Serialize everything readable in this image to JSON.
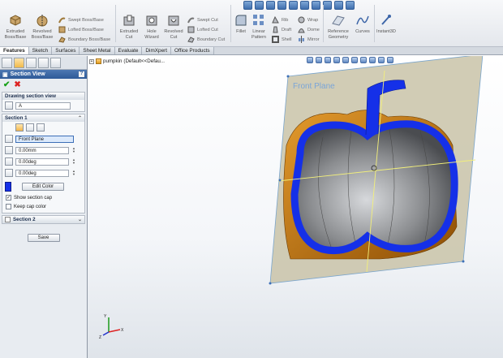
{
  "ribbon": {
    "extruded_boss": "Extruded\nBoss/Base",
    "revolved_boss": "Revolved\nBoss/Base",
    "swept_boss": "Swept Boss/Base",
    "lofted_boss": "Lofted Boss/Base",
    "boundary_boss": "Boundary Boss/Base",
    "extruded_cut": "Extruded\nCut",
    "hole_wizard": "Hole\nWizard",
    "revolved_cut": "Revolved\nCut",
    "swept_cut": "Swept Cut",
    "lofted_cut": "Lofted Cut",
    "boundary_cut": "Boundary Cut",
    "fillet": "Fillet",
    "linear_pattern": "Linear\nPattern",
    "rib": "Rib",
    "draft": "Draft",
    "shell": "Shell",
    "wrap": "Wrap",
    "dome": "Dome",
    "mirror": "Mirror",
    "reference_geometry": "Reference\nGeometry",
    "curves": "Curves",
    "instant3d": "Instant3D"
  },
  "tabs": [
    {
      "label": "Features"
    },
    {
      "label": "Sketch"
    },
    {
      "label": "Surfaces"
    },
    {
      "label": "Sheet Metal"
    },
    {
      "label": "Evaluate"
    },
    {
      "label": "DimXpert"
    },
    {
      "label": "Office Products"
    }
  ],
  "panel": {
    "title": "Section View",
    "help": "?",
    "drawing_group": {
      "title": "Drawing section view",
      "value": "A"
    },
    "section1": {
      "title": "Section 1",
      "plane": "Front Plane",
      "offset": "0.00mm",
      "angle_x": "0.00deg",
      "angle_y": "0.00deg",
      "edit_color": "Edit Color",
      "show_section_cap": "Show section cap",
      "keep_cap_color": "Keep cap color"
    },
    "section2": {
      "title": "Section 2"
    },
    "save": "Save"
  },
  "tree": {
    "part_name": "pumpkin",
    "config": "(Default<<Defau..."
  },
  "viewport": {
    "plane_label": "Front Plane",
    "colors": {
      "cap": "#1530e8",
      "shell_orange": "#c8780f",
      "plane_fill": "#c9c3a8",
      "interior": "#8a8c8f"
    }
  },
  "colors": {
    "title_bar": "#2e5a98",
    "ok_green": "#17a017",
    "cancel_red": "#dd2222"
  }
}
